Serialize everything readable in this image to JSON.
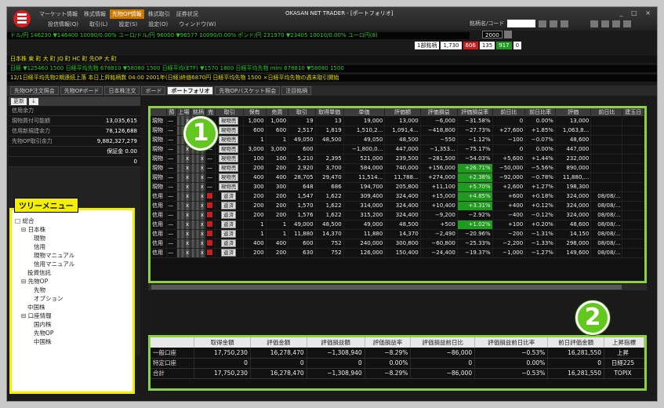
{
  "app": {
    "title": "OKASAN NET TRADER - [ポートフォリオ]",
    "window_controls": "_ □ ×",
    "top_tabs": [
      "マーケット情報",
      "株式情報",
      "先物OP情報",
      "株式取引",
      "証券状況"
    ],
    "active_top_tab": "先物OP情報",
    "menu": [
      "投信情報(Q)",
      "取引(L)",
      "設定(S)",
      "設定(O)",
      "ウィンドウ(W)"
    ],
    "symbol_label": "銘柄名/コード"
  },
  "quote": {
    "box1": "2000",
    "list_label": "1部銘柄",
    "v1": "1,730",
    "v2": "606",
    "v3": "135",
    "v4": "917",
    "v5": "0"
  },
  "tickers": [
    "ドル/円 146230 ▼146400 10090/0.00%   ユーロ/ドル/円 96000 ▼96577 10090/0.00%   ポンド/円 231970 ▼23405 10010/0.00%   ユーロ円(8)",
    "日本株  東  町  大  町  JQ  町  HC  町  先OP  大  町",
    "日経 ▼125460 1500    日経平均先物 678810 ▼58080 1500   日経平均(ETF) ▼1570 1800   日経平均先物 mini 678810 ▼58080 1500",
    "12/1日経平均先物2期連続上落   本日上昇銘柄数   04:00 2001年(日経)終値6870円   日経平均先物 1500   ×日経平均先物の週末取引開始"
  ],
  "tabs": [
    "先物OP注文照会",
    "先物OPボード",
    "日本株注文",
    "ボード",
    "ポートフォリオ",
    "先物OPバスケット照会",
    "注目銘柄"
  ],
  "active_tab": "ポートフォリオ",
  "left": {
    "buttons": [
      "更新",
      "↓"
    ],
    "rows": [
      {
        "label": "信用余力",
        "value": ""
      },
      {
        "label": "現物買付可能額",
        "value": "13,035,615"
      },
      {
        "label": "信用新規建余力",
        "value": "78,126,688"
      },
      {
        "label": "先物OP取引余力",
        "value": "9,882,327,279"
      },
      {
        "label": "",
        "value": "保証金 0.00"
      },
      {
        "label": "",
        "value": "0"
      }
    ]
  },
  "tree": {
    "title": "ツリーメニュー",
    "nodes": [
      {
        "t": "□ 総合",
        "d": 0
      },
      {
        "t": "⊟ 日本株",
        "d": 1
      },
      {
        "t": "現物",
        "d": 3
      },
      {
        "t": "信用",
        "d": 3
      },
      {
        "t": "現物マニュアル",
        "d": 3
      },
      {
        "t": "信用マニュアル",
        "d": 3
      },
      {
        "t": "投資信託",
        "d": 2
      },
      {
        "t": "⊟ 先物OP",
        "d": 1
      },
      {
        "t": "先物",
        "d": 3
      },
      {
        "t": "オプション",
        "d": 3
      },
      {
        "t": "中国株",
        "d": 2
      },
      {
        "t": "⊟ 口座情報",
        "d": 1
      },
      {
        "t": "国内株",
        "d": 3
      },
      {
        "t": "先物OP",
        "d": 3
      },
      {
        "t": "中国株",
        "d": 3
      }
    ]
  },
  "grid": {
    "headers": [
      "",
      "預",
      "上場",
      "銘柄",
      "売",
      "取引",
      "保有",
      "売買",
      "取引",
      "取得単価",
      "単価",
      "評価額",
      "評価損益",
      "評価損益率",
      "前日比",
      "前日比率",
      "評価",
      "前日比",
      "建玉日"
    ],
    "rows": [
      [
        "現物",
        "—",
        "",
        "",
        "—",
        "現物売",
        "1,000",
        "1,000",
        "19",
        "13",
        "19,000",
        "13,000",
        "−6,000",
        "−31.58%",
        "0",
        "0.00%",
        "13,000",
        ""
      ],
      [
        "現物",
        "—",
        "",
        "",
        "—",
        "現物売",
        "600",
        "600",
        "2,517",
        "1,819",
        "1,510,2...",
        "1,091,4...",
        "−418,800",
        "−27.73%",
        "+27,600",
        "+1.85%",
        "1,063,8...",
        ""
      ],
      [
        "現物",
        "—",
        "",
        "",
        "—",
        "現物売",
        "1",
        "1",
        "49,050",
        "48,500",
        "49,050",
        "48,500",
        "−550",
        "−1.12%",
        "−100",
        "−0.07%",
        "48,600",
        ""
      ],
      [
        "現物",
        "—",
        "",
        "",
        "—",
        "現物売",
        "3,000",
        "3,000",
        "600",
        "",
        "−1,800,0...",
        "447,000",
        "−1,353...",
        "−75.17%",
        "0",
        "0.00%",
        "447,000",
        ""
      ],
      [
        "現物",
        "—",
        "",
        "",
        "—",
        "現物売",
        "100",
        "100",
        "5,210",
        "2,395",
        "521,000",
        "239,500",
        "−281,500",
        "−54.03%",
        "+5,600",
        "+1.44%",
        "232,000",
        ""
      ],
      [
        "現物",
        "—",
        "",
        "",
        "—",
        "現物売",
        "200",
        "200",
        "2,920",
        "3,700",
        "584,000",
        "740,000",
        "+156,000",
        "+26.71%",
        "−50,000",
        "−5.56%",
        "890,000",
        ""
      ],
      [
        "現物",
        "—",
        "",
        "",
        "—",
        "現物売",
        "400",
        "400",
        "28,705",
        "29,470",
        "11,514...",
        "11,788...",
        "+274,000",
        "+2.38%",
        "−92,000",
        "−0.78%",
        "11,880,...",
        ""
      ],
      [
        "現物",
        "—",
        "",
        "",
        "—",
        "現物売",
        "300",
        "300",
        "648",
        "686",
        "194,700",
        "205,800",
        "+11,100",
        "+5.70%",
        "+2,600",
        "+1.27%",
        "198,300",
        ""
      ],
      [
        "信用",
        "—",
        "",
        "",
        "売",
        "返済",
        "200",
        "200",
        "1,547",
        "1,622",
        "309,400",
        "324,400",
        "+15,000",
        "+4.85%",
        "+600",
        "+0.18%",
        "324,000",
        "08/08/..."
      ],
      [
        "信用",
        "—",
        "",
        "",
        "売",
        "返済",
        "200",
        "200",
        "1,570",
        "1,622",
        "314,000",
        "324,400",
        "+10,400",
        "+3.31%",
        "+400",
        "+0.12%",
        "324,000",
        "08/08/..."
      ],
      [
        "信用",
        "—",
        "",
        "",
        "売",
        "返済",
        "200",
        "200",
        "1,576",
        "1,622",
        "315,200",
        "324,400",
        "−9,200",
        "−2.92%",
        "−400",
        "−0.12%",
        "324,000",
        "08/08/..."
      ],
      [
        "信用",
        "—",
        "",
        "",
        "売",
        "返済",
        "1",
        "1",
        "49,000",
        "48,500",
        "49,000",
        "48,500",
        "+500",
        "+1.02%",
        "+100",
        "+0.20%",
        "48,600",
        "08/08/..."
      ],
      [
        "信用",
        "—",
        "",
        "",
        "売",
        "返済",
        "1",
        "1",
        "11,880",
        "14,370",
        "11,880",
        "14,370",
        "−2,490",
        "−20.96%",
        "−200",
        "−1.31%",
        "14,150",
        "08/08/..."
      ],
      [
        "信用",
        "—",
        "",
        "",
        "売",
        "返済",
        "400",
        "400",
        "600",
        "752",
        "240,000",
        "300,800",
        "−60,800",
        "−25.33%",
        "−2,200",
        "−1.33%",
        "298,000",
        "08/08/..."
      ],
      [
        "信用",
        "—",
        "",
        "",
        "売",
        "返済",
        "200",
        "200",
        "630",
        "752",
        "126,000",
        "150,400",
        "−24,400",
        "−19.37%",
        "−1,000",
        "−1.27%",
        "149,600",
        "08/08/..."
      ]
    ]
  },
  "summary": {
    "headers": [
      "",
      "取得金額",
      "評価金額",
      "評価損益額",
      "評価損益率",
      "評価損益前日比",
      "評価損益前日比率",
      "前日評価金額",
      "上昇指標"
    ],
    "rows": [
      [
        "一般口座",
        "17,750,230",
        "16,278,470",
        "−1,308,940",
        "−8.29%",
        "−86,000",
        "−0.53%",
        "16,281,550",
        "上昇"
      ],
      [
        "特定口座",
        "0",
        "0",
        "0",
        "0.00%",
        "0",
        "0.00%",
        "0",
        "日経225"
      ],
      [
        "合計",
        "17,750,230",
        "16,278,470",
        "−1,308,940",
        "−8.29%",
        "−86,000",
        "−0.53%",
        "16,281,550",
        "TOPIX"
      ]
    ]
  },
  "badges": {
    "one": "1",
    "two": "2"
  },
  "colors": {
    "accent_green": "#8cd23c",
    "badge": "#62c81e",
    "tree_border": "#f2f000"
  }
}
